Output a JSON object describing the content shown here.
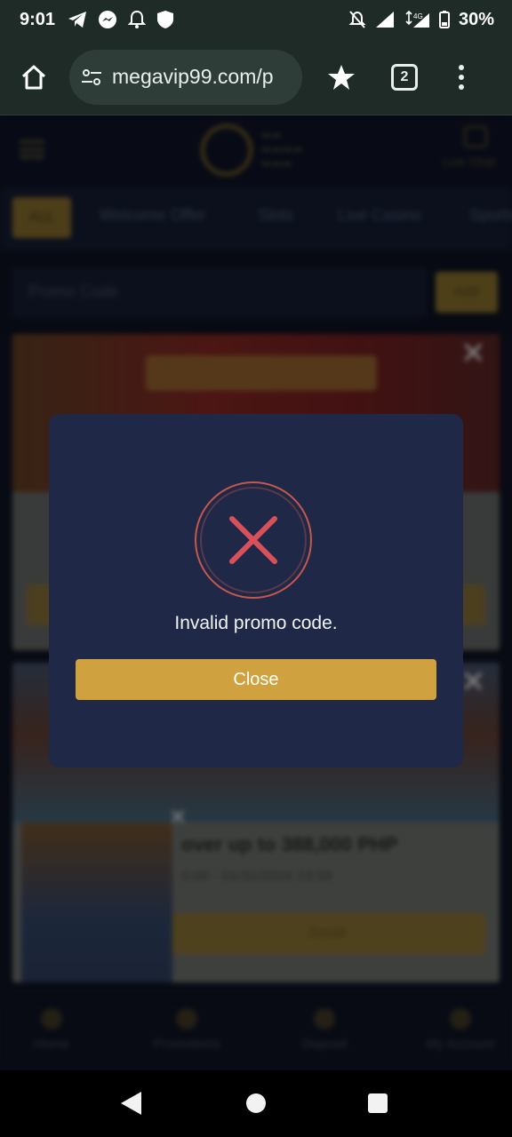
{
  "status_bar": {
    "time": "9:01",
    "battery": "30%",
    "network": "4G"
  },
  "browser": {
    "url": "megavip99.com/p",
    "tab_count": "2"
  },
  "site": {
    "live_chat_label": "Live Chat",
    "categories": [
      "ALL",
      "Welcome Offer",
      "Slots",
      "Live Casino",
      "Sports"
    ],
    "promo_placeholder": "Promo Code",
    "apply_label": "Add",
    "card2_title": "over up to 388,000 PHP",
    "card2_date": "0:00 - 01/31/2024 23:59",
    "card2_button": "Detail",
    "bottom_nav": [
      "Home",
      "Promotions",
      "Deposit",
      "My Account"
    ]
  },
  "modal": {
    "message": "Invalid promo code.",
    "close_label": "Close",
    "icon": "error-x-icon",
    "accent_color": "#cfa23f",
    "error_color": "#d8505a"
  }
}
